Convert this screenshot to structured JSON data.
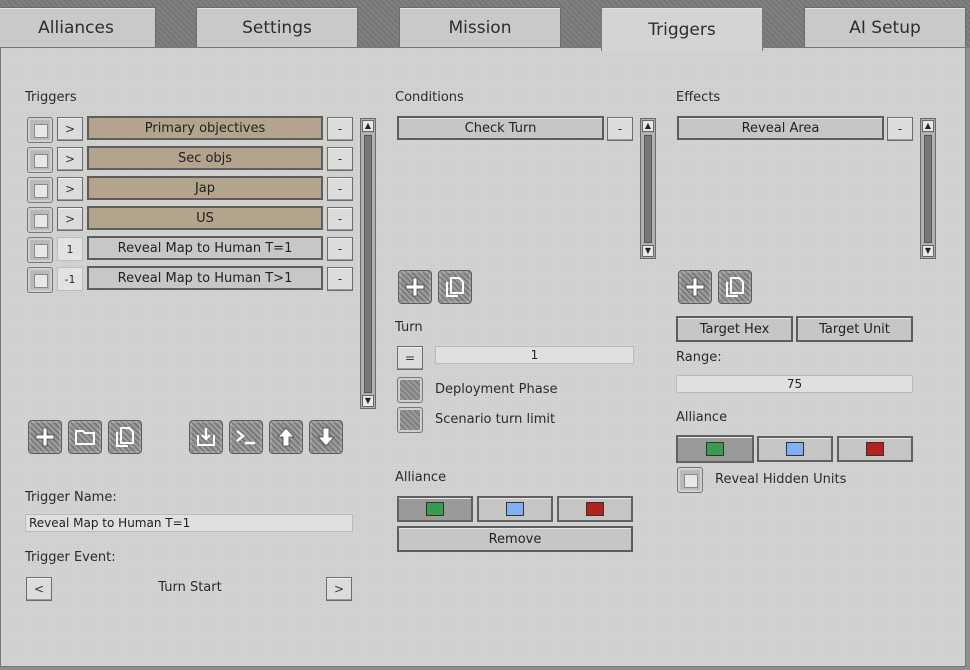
{
  "tabs": [
    {
      "label": "Alliances",
      "active": false
    },
    {
      "label": "Settings",
      "active": false
    },
    {
      "label": "Mission",
      "active": false
    },
    {
      "label": "Triggers",
      "active": true
    },
    {
      "label": "AI Setup",
      "active": false
    }
  ],
  "triggers": {
    "heading": "Triggers",
    "rows": [
      {
        "order": ">",
        "label": "Primary objectives",
        "remove": "-"
      },
      {
        "order": ">",
        "label": "Sec objs",
        "remove": "-"
      },
      {
        "order": ">",
        "label": "Jap",
        "remove": "-"
      },
      {
        "order": ">",
        "label": "US",
        "remove": "-"
      },
      {
        "order": "1",
        "label": "Reveal Map to Human T=1",
        "remove": "-"
      },
      {
        "order": "-1",
        "label": "Reveal Map to Human T>1",
        "remove": "-"
      }
    ],
    "name_label": "Trigger Name:",
    "name_value": "Reveal Map to Human T=1",
    "event_label": "Trigger Event:",
    "event_prev": "<",
    "event_value": "Turn Start",
    "event_next": ">"
  },
  "conditions": {
    "heading": "Conditions",
    "items": [
      {
        "label": "Check Turn",
        "remove": "-"
      }
    ],
    "turn_label": "Turn",
    "turn_operator": "=",
    "turn_value": "1",
    "deployment_label": "Deployment Phase",
    "turn_limit_label": "Scenario turn limit",
    "alliance_label": "Alliance",
    "remove_label": "Remove"
  },
  "effects": {
    "heading": "Effects",
    "items": [
      {
        "label": "Reveal Area",
        "remove": "-"
      }
    ],
    "target_hex_label": "Target Hex",
    "target_unit_label": "Target Unit",
    "range_label": "Range:",
    "range_value": "75",
    "alliance_label": "Alliance",
    "reveal_hidden_label": "Reveal Hidden Units"
  },
  "colors": {
    "green": "#3a9a4f",
    "blue": "#7fb0f2",
    "red": "#b3221c",
    "trigger_fill": "#b3a48d"
  },
  "icons": {
    "add": "plus-icon",
    "folder": "folder-icon",
    "copy": "copy-icon",
    "import": "import-icon",
    "console": "console-icon",
    "up": "arrow-up-icon",
    "down": "arrow-down-icon"
  }
}
